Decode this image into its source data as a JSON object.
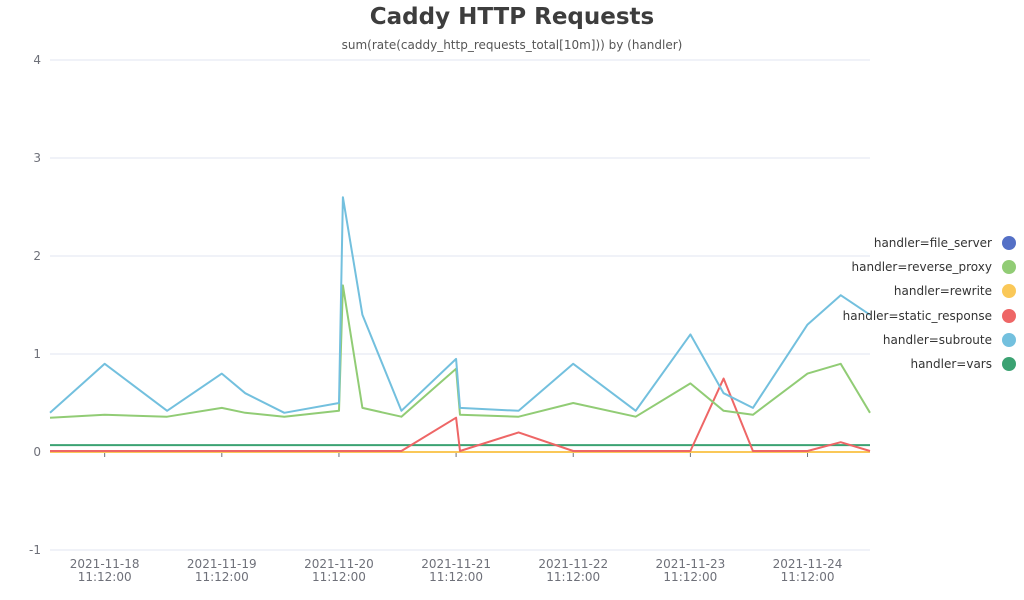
{
  "chart_data": {
    "type": "line",
    "title": "Caddy HTTP Requests",
    "subtitle": "sum(rate(caddy_http_requests_total[10m])) by (handler)",
    "ylim": [
      -1,
      4
    ],
    "y_ticks": [
      "4",
      "3",
      "2",
      "1",
      "0",
      "-1"
    ],
    "x_ticks": [
      {
        "date": "2021-11-18",
        "time": "11:12:00"
      },
      {
        "date": "2021-11-19",
        "time": "11:12:00"
      },
      {
        "date": "2021-11-20",
        "time": "11:12:00"
      },
      {
        "date": "2021-11-21",
        "time": "11:12:00"
      },
      {
        "date": "2021-11-22",
        "time": "11:12:00"
      },
      {
        "date": "2021-11-23",
        "time": "11:12:00"
      },
      {
        "date": "2021-11-24",
        "time": "11:12:00"
      }
    ],
    "grid": true,
    "legend_position": "right",
    "x": [
      "2021-11-18 00:00",
      "2021-11-18 11:12",
      "2021-11-19 00:00",
      "2021-11-19 11:12",
      "2021-11-19 16:00",
      "2021-11-20 00:00",
      "2021-11-20 11:12",
      "2021-11-20 12:00",
      "2021-11-20 16:00",
      "2021-11-21 00:00",
      "2021-11-21 11:12",
      "2021-11-21 12:00",
      "2021-11-22 00:00",
      "2021-11-22 11:12",
      "2021-11-23 00:00",
      "2021-11-23 11:12",
      "2021-11-23 18:00",
      "2021-11-24 00:00",
      "2021-11-24 11:12",
      "2021-11-24 18:00",
      "2021-11-25 00:00"
    ],
    "series": [
      {
        "name": "handler=file_server",
        "color": "#5470c6",
        "values": [
          0,
          0,
          0,
          0,
          0,
          0,
          0,
          0,
          0,
          0,
          0,
          0,
          0,
          0,
          0,
          0,
          0,
          0,
          0,
          0,
          0
        ]
      },
      {
        "name": "handler=reverse_proxy",
        "color": "#91cc75",
        "values": [
          0.35,
          0.38,
          0.36,
          0.45,
          0.4,
          0.36,
          0.42,
          1.7,
          0.45,
          0.36,
          0.85,
          0.38,
          0.36,
          0.5,
          0.36,
          0.7,
          0.42,
          0.38,
          0.8,
          0.9,
          0.4
        ]
      },
      {
        "name": "handler=rewrite",
        "color": "#fac858",
        "values": [
          0,
          0,
          0,
          0,
          0,
          0,
          0,
          0,
          0,
          0,
          0,
          0,
          0,
          0,
          0,
          0,
          0,
          0,
          0,
          0,
          0
        ]
      },
      {
        "name": "handler=static_response",
        "color": "#ee6666",
        "values": [
          0.01,
          0.01,
          0.01,
          0.01,
          0.01,
          0.01,
          0.01,
          0.01,
          0.01,
          0.01,
          0.35,
          0.01,
          0.2,
          0.01,
          0.01,
          0.01,
          0.75,
          0.01,
          0.01,
          0.1,
          0.01
        ]
      },
      {
        "name": "handler=subroute",
        "color": "#73c0de",
        "values": [
          0.4,
          0.9,
          0.42,
          0.8,
          0.6,
          0.4,
          0.5,
          2.6,
          1.4,
          0.42,
          0.95,
          0.45,
          0.42,
          0.9,
          0.42,
          1.2,
          0.6,
          0.45,
          1.3,
          1.6,
          1.4
        ]
      },
      {
        "name": "handler=vars",
        "color": "#3ba272",
        "values": [
          0.07,
          0.07,
          0.07,
          0.07,
          0.07,
          0.07,
          0.07,
          0.07,
          0.07,
          0.07,
          0.07,
          0.07,
          0.07,
          0.07,
          0.07,
          0.07,
          0.07,
          0.07,
          0.07,
          0.07,
          0.07
        ]
      }
    ]
  }
}
